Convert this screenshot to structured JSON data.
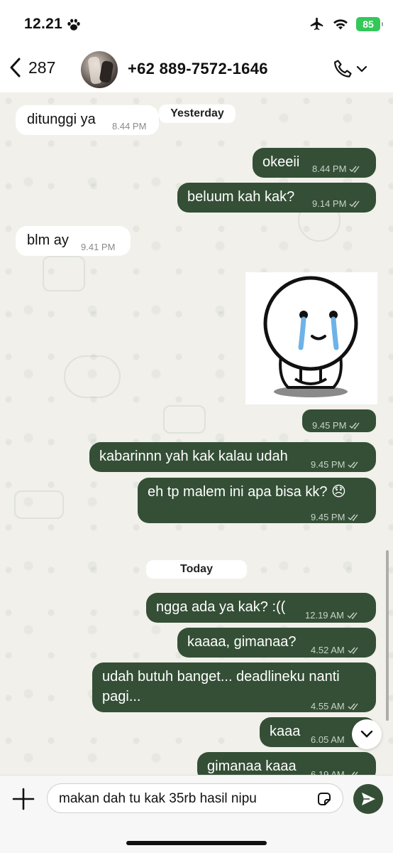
{
  "status_bar": {
    "time": "12.21",
    "battery": "85"
  },
  "header": {
    "back_count": "287",
    "contact_name": "+62 889-7572-1646"
  },
  "chat": {
    "day_labels": {
      "yesterday": "Yesterday",
      "today": "Today"
    },
    "messages": [
      {
        "direction": "in",
        "text": "ditunggi ya",
        "time": "8.44 PM"
      },
      {
        "direction": "out",
        "text": "okeeii",
        "time": "8.44 PM"
      },
      {
        "direction": "out",
        "text": "beluum kah kak?",
        "time": "9.14 PM"
      },
      {
        "direction": "in",
        "text": "blm ay",
        "time": "9.41 PM"
      },
      {
        "direction": "out",
        "type": "sticker",
        "sticker": "crying-character",
        "time": "9.45 PM"
      },
      {
        "direction": "out",
        "text": "kabarinnn yah kak kalau udah",
        "time": "9.45 PM"
      },
      {
        "direction": "out",
        "text": "eh tp malem ini apa bisa kk? 😞",
        "time": "9.45 PM"
      },
      {
        "direction": "out",
        "text": "ngga ada ya kak? :((",
        "time": "12.19 AM"
      },
      {
        "direction": "out",
        "text": "kaaaa, gimanaa?",
        "time": "4.52 AM"
      },
      {
        "direction": "out",
        "text_line1": "udah butuh banget... deadlineku nanti",
        "text_line2": "pagi...",
        "time": "4.55 AM"
      },
      {
        "direction": "out",
        "text": "kaaa",
        "time": "6.05 AM"
      },
      {
        "direction": "out",
        "text": "gimanaa kaaa",
        "time": "6.19 AM"
      }
    ]
  },
  "input": {
    "value": "makan dah tu kak 35rb hasil nipu"
  },
  "colors": {
    "outgoing_bubble": "#344f36",
    "incoming_bubble": "#ffffff",
    "battery": "#34c759"
  },
  "icons": [
    "paw-icon",
    "airplane-icon",
    "wifi-icon",
    "battery-icon",
    "back-chevron-icon",
    "phone-icon",
    "chevron-down-icon",
    "read-ticks-icon",
    "plus-icon",
    "sticker-icon",
    "send-icon"
  ]
}
